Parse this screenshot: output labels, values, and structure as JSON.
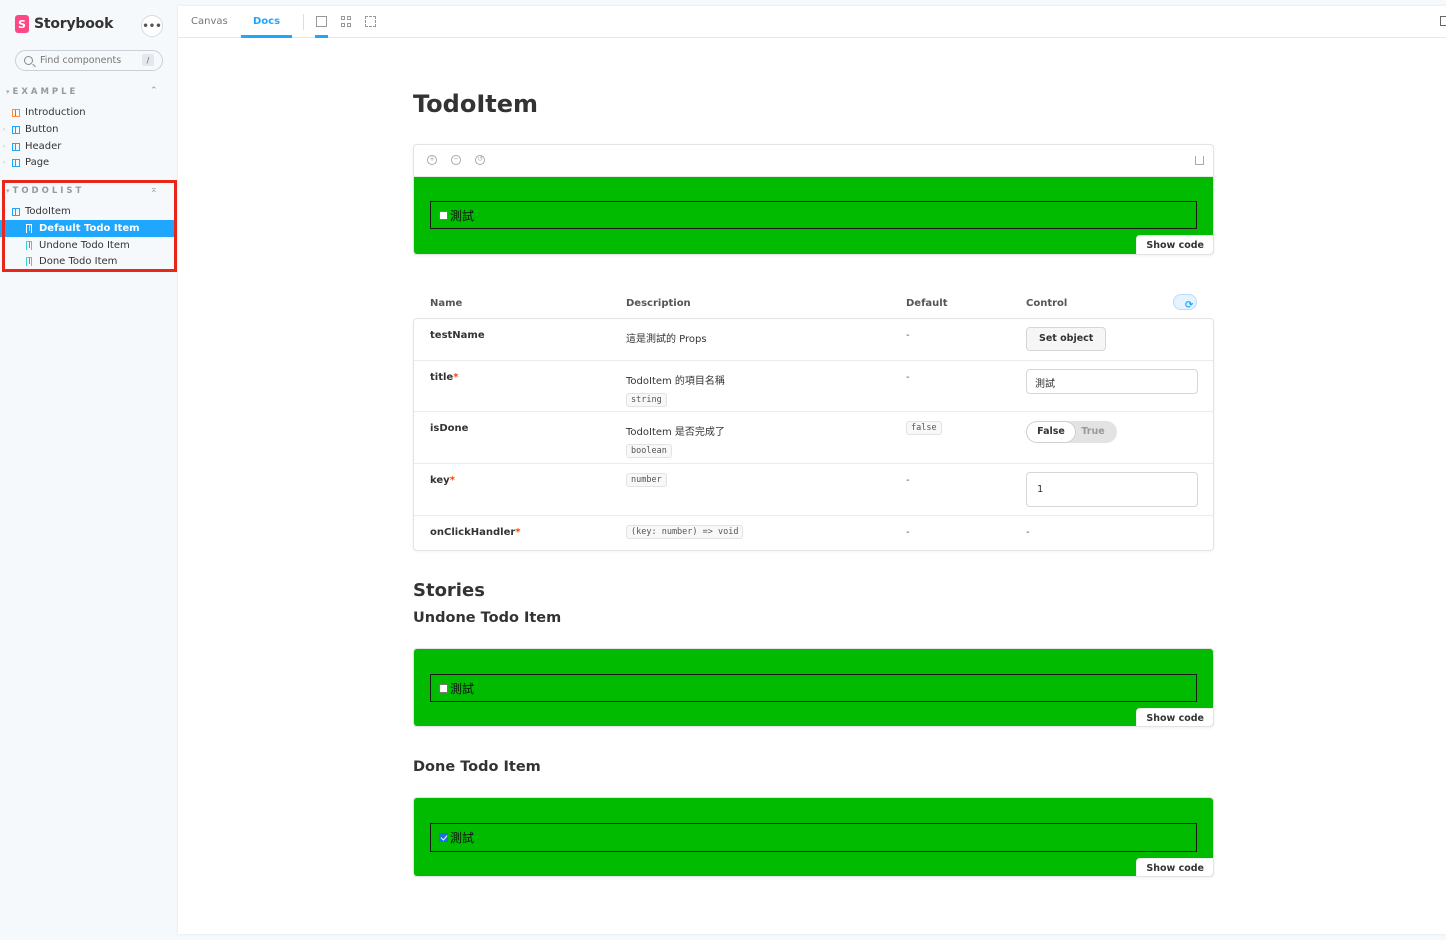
{
  "sidebar": {
    "brand": "Storybook",
    "search_placeholder": "Find components",
    "search_shortcut": "/",
    "groups": [
      {
        "title": "EXAMPLE",
        "items": [
          {
            "label": "Introduction",
            "icon": "document-icon"
          },
          {
            "label": "Button",
            "icon": "component-icon"
          },
          {
            "label": "Header",
            "icon": "component-icon"
          },
          {
            "label": "Page",
            "icon": "component-icon"
          }
        ]
      },
      {
        "title": "TODOLIST",
        "component": "TodoItem",
        "stories": [
          {
            "label": "Default Todo Item",
            "selected": true
          },
          {
            "label": "Undone Todo Item",
            "selected": false
          },
          {
            "label": "Done Todo Item",
            "selected": false
          }
        ]
      }
    ]
  },
  "toolbar": {
    "tabs": [
      {
        "label": "Canvas",
        "active": false
      },
      {
        "label": "Docs",
        "active": true
      }
    ]
  },
  "docs": {
    "title": "TodoItem",
    "primary_preview": {
      "checked": false,
      "text": "測試",
      "show_code": "Show code"
    },
    "args_table": {
      "headers": {
        "name": "Name",
        "description": "Description",
        "default": "Default",
        "control": "Control"
      },
      "rows": [
        {
          "name": "testName",
          "required": false,
          "description": "這是測試的 Props",
          "type": "",
          "default": "-",
          "control": {
            "kind": "button",
            "label": "Set object"
          }
        },
        {
          "name": "title",
          "required": true,
          "description": "TodoItem 的項目名稱",
          "type": "string",
          "default": "-",
          "control": {
            "kind": "text",
            "value": "測試"
          }
        },
        {
          "name": "isDone",
          "required": false,
          "description": "TodoItem 是否完成了",
          "type": "boolean",
          "default": "false",
          "control": {
            "kind": "toggle",
            "on_label": "False",
            "off_label": "True"
          }
        },
        {
          "name": "key",
          "required": true,
          "description": "",
          "type": "number",
          "default": "-",
          "control": {
            "kind": "number",
            "value": "1"
          }
        },
        {
          "name": "onClickHandler",
          "required": true,
          "description": "",
          "type": "(key: number) => void",
          "default": "-",
          "control": {
            "kind": "none",
            "value": "-"
          }
        }
      ],
      "required_marker": "*"
    },
    "stories_heading": "Stories",
    "stories": [
      {
        "title": "Undone Todo Item",
        "checked": false,
        "text": "測試",
        "show_code": "Show code"
      },
      {
        "title": "Done Todo Item",
        "checked": true,
        "text": "測試",
        "show_code": "Show code"
      }
    ]
  },
  "colors": {
    "accent": "#1ea7fd",
    "brand": "#ff4785",
    "story_canvas": "#00bb00",
    "highlight": "#e8271a"
  }
}
